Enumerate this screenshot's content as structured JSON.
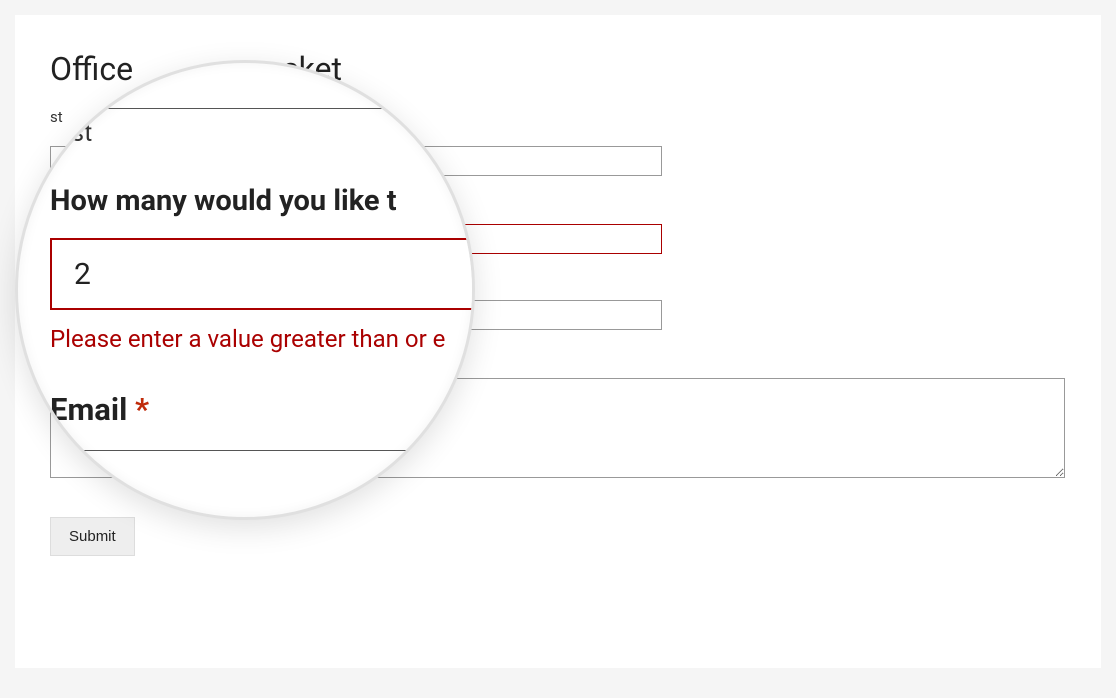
{
  "form": {
    "title_prefix": "Office",
    "title_suffix": "acket",
    "sublabel": "st",
    "quantity_label": "How many would you like t",
    "quantity_value": "2",
    "quantity_error": "Please enter a value greater than or e",
    "email_label": "Email",
    "required_mark": "*",
    "submit_label": "Submit"
  },
  "magnifier": {
    "sublabel": "..st",
    "quantity_label": "How many would you like t",
    "quantity_value": "2",
    "quantity_error": "Please enter a value greater than or e",
    "email_label": "Email",
    "required_mark": "*"
  }
}
